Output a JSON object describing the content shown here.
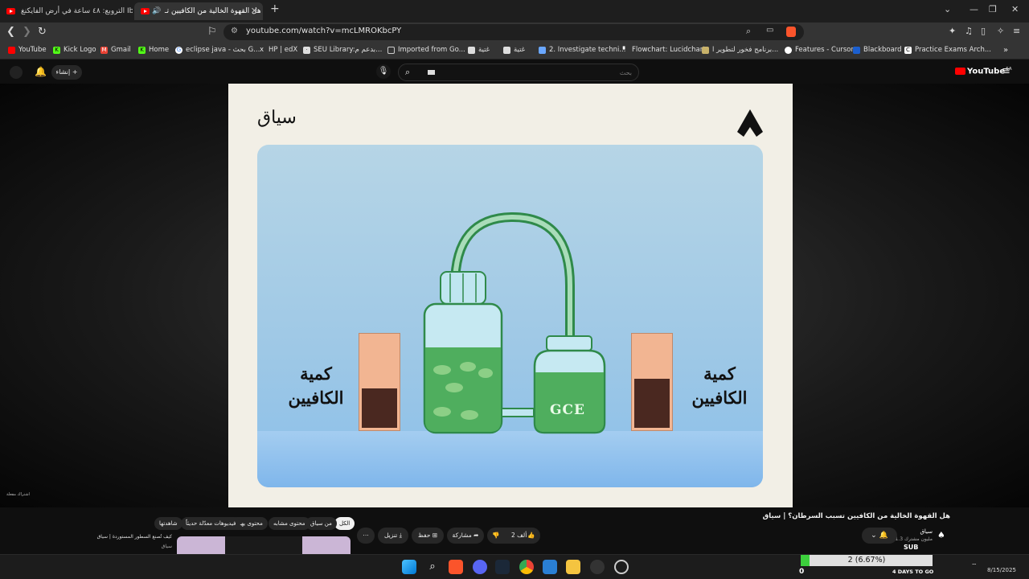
{
  "browser": {
    "tabs": [
      {
        "title": "التروبع: ٤٨ ساعة في أرض الفايكنغ Ibe"
      },
      {
        "title": "هل القهوة الخالية من الكافيين تـ"
      }
    ],
    "url": "youtube.com/watch?v=mcLMROKbcPY",
    "bookmarks": [
      "YouTube",
      "Kick Logo",
      "Gmail",
      "Home",
      "eclipse java - بحث G...",
      "HP | edX",
      "SEU Library:بدعم م...",
      "Imported from Go...",
      "غتية",
      "غتية",
      "2. Investigate techni...",
      "Flowchart: Lucidchart",
      "برنامج فخور لتطوير ا...",
      "Features - Cursor",
      "Blackboard",
      "Practice Exams Arch..."
    ]
  },
  "youtube": {
    "create_label": "إنشاء",
    "search_placeholder": "بحث",
    "logo": "YouTube",
    "logo_region": "SA"
  },
  "video": {
    "brand_title": "سياق",
    "caffeine_label_line1": "كمية",
    "caffeine_label_line2": "الكافيين",
    "jar_label": "GCE",
    "left_meter_fill": 0.42,
    "right_meter_fill": 0.53,
    "watermark": "اشتراك مفعلة"
  },
  "below": {
    "title": "هل القهوة الخالية من الكافيين تسبب السرطان؟ | سياق",
    "channel": "سياق",
    "subscribers": "1.3 مليون مشترك",
    "like_count": "2 ألف",
    "share_label": "مشاركة",
    "save_label": "حفظ",
    "download_label": "تنزيل",
    "chips": [
      "الكل",
      "من سياق",
      "محتوى مشابه",
      "محتوى يهمك",
      "فيديوهات معدّلة حديثاً",
      "شاهدتها"
    ],
    "related_title": "كيف تُصنع السطور المستوردة | سياق",
    "related_channel": "سياق"
  },
  "overlay": {
    "sub_label": "SUB",
    "progress_text": "2 (6.67%)",
    "progress_value": 0.0667,
    "zero": "0",
    "days_to_go": "4 DAYS TO GO"
  },
  "taskbar": {
    "date": "8/15/2025"
  }
}
